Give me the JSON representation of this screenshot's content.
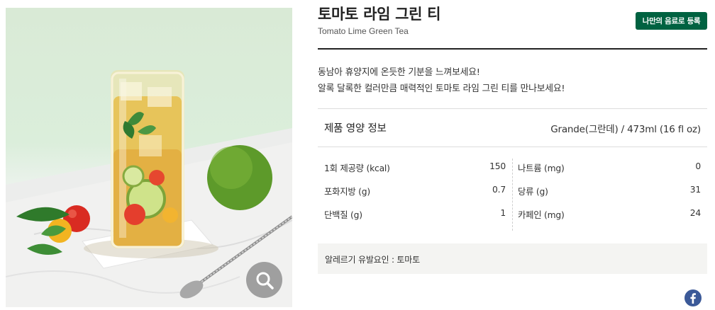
{
  "product": {
    "title": "토마토 라임 그린 티",
    "subtitle": "Tomato Lime Green Tea",
    "register_button_label": "나만의 음료로 등록",
    "description": [
      "동남아 휴양지에 온듯한 기분을 느껴보세요!",
      "알록 달록한 컬러만큼 매력적인 토마토 라임 그린 티를 만나보세요!"
    ]
  },
  "nutrition": {
    "heading": "제품 영양 정보",
    "serving": "Grande(그란데) / 473ml (16 fl oz)",
    "left_rows": [
      {
        "label": "1회 제공량 (kcal)",
        "value": "150"
      },
      {
        "label": "포화지방 (g)",
        "value": "0.7"
      },
      {
        "label": "단백질 (g)",
        "value": "1"
      }
    ],
    "right_rows": [
      {
        "label": "나트륨 (mg)",
        "value": "0"
      },
      {
        "label": "당류 (g)",
        "value": "31"
      },
      {
        "label": "카페인 (mg)",
        "value": "24"
      }
    ]
  },
  "allergy": {
    "text": "알레르기 유발요인 : 토마토"
  },
  "icons": {
    "zoom": "magnifier-icon",
    "share": "facebook-icon"
  },
  "colors": {
    "brand_green": "#006241",
    "facebook_blue": "#3b5998",
    "allergy_bg": "#f4f4f2"
  }
}
